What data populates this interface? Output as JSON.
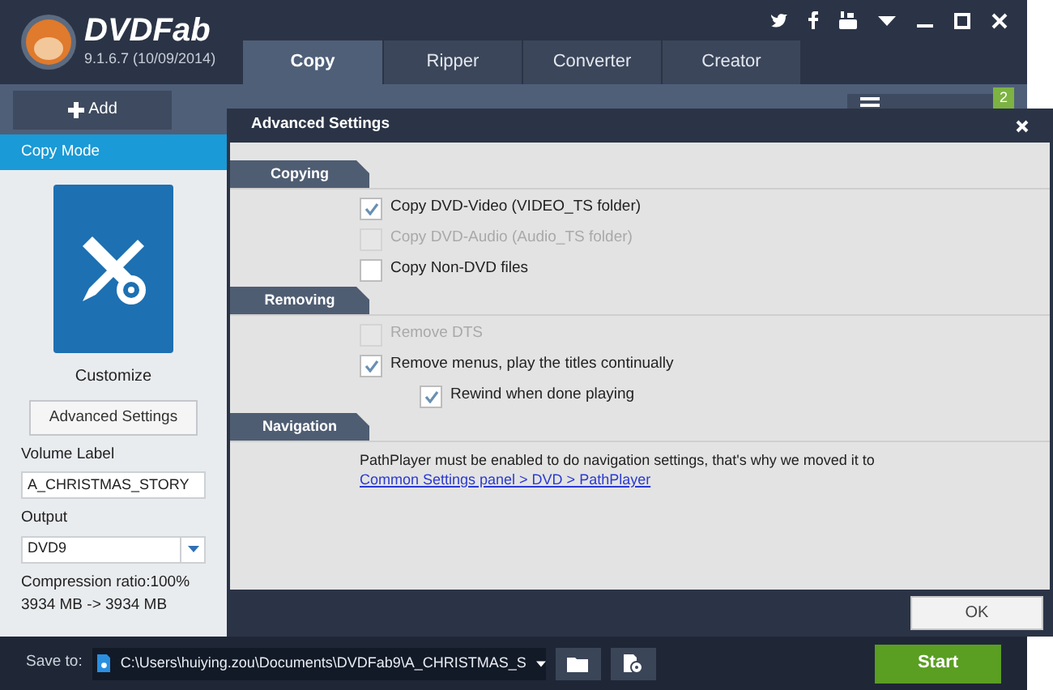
{
  "app": {
    "name": "DVDFab",
    "version": "9.1.6.7 (10/09/2014)"
  },
  "tabs": [
    {
      "label": "Copy",
      "selected": true
    },
    {
      "label": "Ripper",
      "selected": false
    },
    {
      "label": "Converter",
      "selected": false
    },
    {
      "label": "Creator",
      "selected": false
    }
  ],
  "toolbar": {
    "add": "Add",
    "queue_badge": "2"
  },
  "sidebar": {
    "header": "Copy Mode",
    "mode": "Customize",
    "advanced_button": "Advanced Settings",
    "volume_label": "Volume Label",
    "volume_value": "A_CHRISTMAS_STORY",
    "output_label": "Output",
    "output_value": "DVD9",
    "compression": "Compression ratio:100%",
    "size": "3934 MB -> 3934 MB"
  },
  "dialog": {
    "title": "Advanced Settings",
    "sections": [
      {
        "title": "Copying",
        "items": [
          {
            "kind": "checkbox",
            "label": "Copy DVD-Video (VIDEO_TS folder)",
            "checked": true,
            "disabled": false,
            "indent": false
          },
          {
            "kind": "checkbox",
            "label": "Copy DVD-Audio (Audio_TS folder)",
            "checked": false,
            "disabled": true,
            "indent": false
          },
          {
            "kind": "checkbox",
            "label": "Copy Non-DVD files",
            "checked": false,
            "disabled": false,
            "indent": false
          }
        ]
      },
      {
        "title": "Removing",
        "items": [
          {
            "kind": "checkbox",
            "label": "Remove DTS",
            "checked": false,
            "disabled": true,
            "indent": false
          },
          {
            "kind": "checkbox",
            "label": "Remove menus, play the titles continually",
            "checked": true,
            "disabled": false,
            "indent": false
          },
          {
            "kind": "checkbox",
            "label": "Rewind when done playing",
            "checked": true,
            "disabled": false,
            "indent": true
          }
        ]
      },
      {
        "title": "Navigation",
        "items": [
          {
            "kind": "note",
            "text": "PathPlayer must be enabled to do navigation settings, that's why we moved it to ",
            "link": "Common Settings panel > DVD > PathPlayer"
          }
        ]
      }
    ],
    "ok": "OK"
  },
  "bottom": {
    "save_label": "Save to:",
    "path": "C:\\Users\\huiying.zou\\Documents\\DVDFab9\\A_CHRISTMAS_S",
    "start": "Start"
  }
}
